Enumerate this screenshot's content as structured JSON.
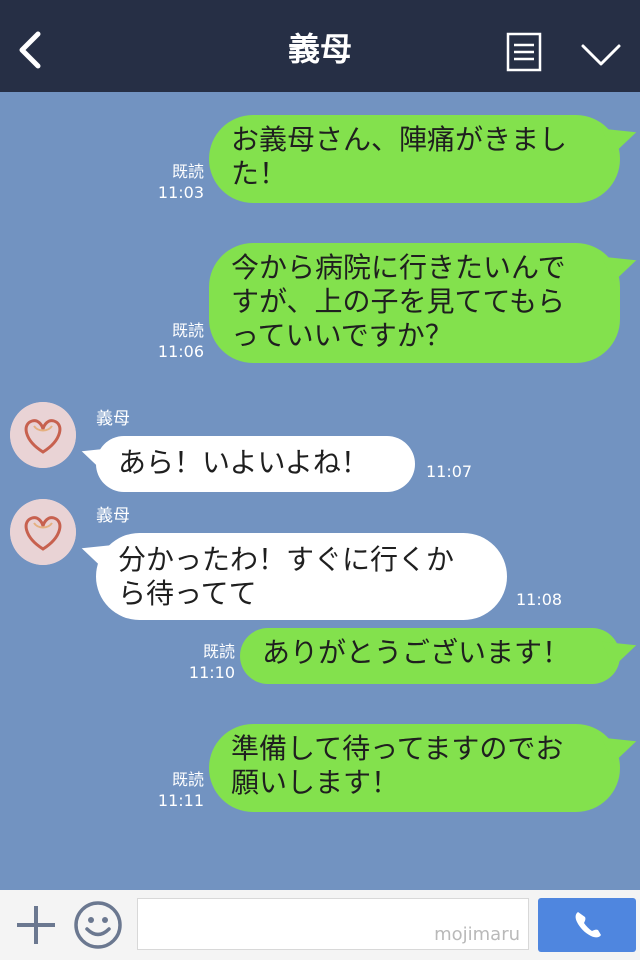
{
  "header": {
    "title": "義母",
    "back_icon": "chevron-left-icon",
    "menu_icon": "list-icon",
    "collapse_icon": "chevron-down-icon"
  },
  "messages": [
    {
      "from": "me",
      "lines": [
        "お義母さん、陣痛がきまし",
        "た！"
      ],
      "read": "既読",
      "time": "11:03"
    },
    {
      "from": "me",
      "lines": [
        "今から病院に行きたいんで",
        "すが、上の子を見ててもら",
        "っていいですか？"
      ],
      "read": "既読",
      "time": "11:06"
    },
    {
      "from": "them",
      "sender": "義母",
      "lines": [
        "あら！いよいよね！"
      ],
      "time": "11:07"
    },
    {
      "from": "them",
      "sender": "義母",
      "lines": [
        "分かったわ！すぐに行くか",
        "ら待ってて"
      ],
      "time": "11:08"
    },
    {
      "from": "me",
      "lines": [
        "ありがとうございます！"
      ],
      "read": "既読",
      "time": "11:10"
    },
    {
      "from": "me",
      "lines": [
        "準備して待ってますのでお",
        "願いします！"
      ],
      "read": "既読",
      "time": "11:11"
    }
  ],
  "input": {
    "watermark": "mojimaru",
    "plus_icon": "plus-icon",
    "emoji_icon": "smiley-icon",
    "call_icon": "phone-icon"
  },
  "colors": {
    "header_bg": "#262f45",
    "chat_bg": "#7293c1",
    "my_bubble": "#83e14d",
    "their_bubble": "#ffffff",
    "call_button": "#4f86df"
  }
}
